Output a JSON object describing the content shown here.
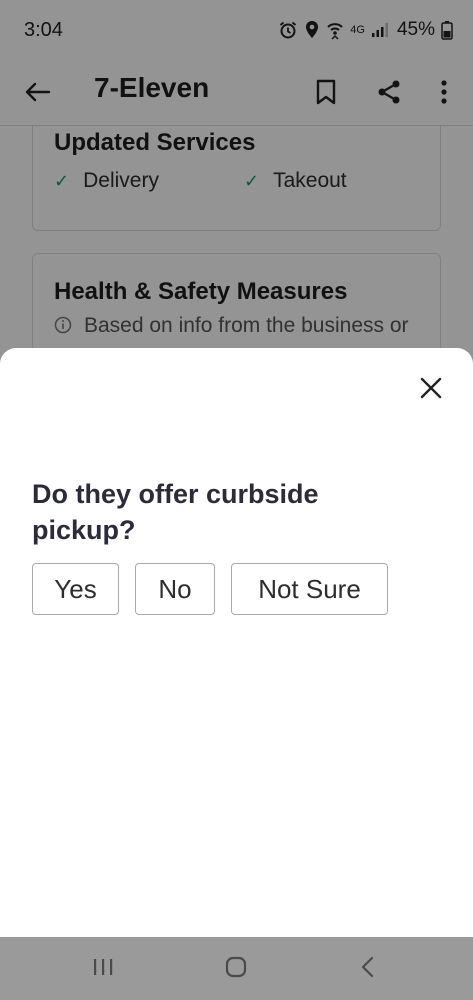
{
  "status_bar": {
    "time": "3:04",
    "network_label": "4G",
    "battery_text": "45%"
  },
  "app_bar": {
    "title": "7-Eleven",
    "icons": [
      "back-arrow-icon",
      "bookmark-icon",
      "share-icon",
      "more-vert-icon"
    ]
  },
  "updated_services": {
    "heading": "Updated Services",
    "items": [
      {
        "label": "Delivery",
        "icon": "check-icon"
      },
      {
        "label": "Takeout",
        "icon": "check-icon"
      }
    ]
  },
  "health_safety": {
    "heading": "Health & Safety Measures",
    "info_text": "Based on info from the business or"
  },
  "sheet": {
    "question": "Do they offer curbside pickup?",
    "answers": [
      "Yes",
      "No",
      "Not Sure"
    ],
    "close_icon": "close-icon"
  },
  "nav_bar": {
    "icons": [
      "recent-apps-icon",
      "home-icon",
      "back-icon"
    ]
  },
  "colors": {
    "check_green": "#0f9d74",
    "overlay": "rgba(0,0,0,0.42)",
    "nav_bar": "#9a9a9a"
  }
}
